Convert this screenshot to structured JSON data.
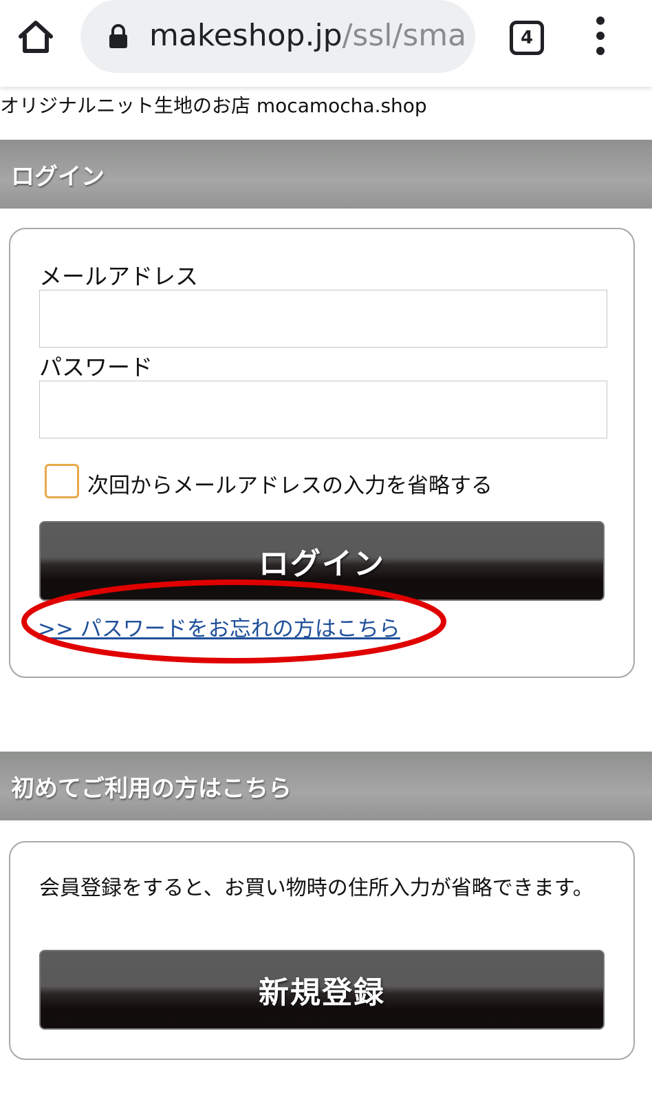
{
  "browser": {
    "url_domain": "makeshop.jp",
    "url_path": "/ssl/smart",
    "tab_count": "4",
    "icons": [
      "home-icon",
      "lock-icon",
      "tab-switcher-icon",
      "overflow-menu-icon"
    ]
  },
  "shop_name": "オリジナルニット生地のお店 mocamocha.shop",
  "login_section": {
    "header": "ログイン",
    "email_label": "メールアドレス",
    "email_value": "",
    "password_label": "パスワード",
    "password_value": "",
    "remember_label": "次回からメールアドレスの入力を省略する",
    "remember_checked": false,
    "login_button": "ログイン",
    "forgot_link": ">> パスワードをお忘れの方はこちら"
  },
  "register_section": {
    "header": "初めてご利用の方はこちら",
    "description": "会員登録をすると、お買い物時の住所入力が省略できます。",
    "register_button": "新規登録"
  },
  "colors": {
    "header_gray": "#9a9b9a",
    "button_dark": "#130e0e",
    "checkbox_border": "#e8a94a",
    "link_blue": "#1f4f9a",
    "highlight_red": "#e00000"
  }
}
